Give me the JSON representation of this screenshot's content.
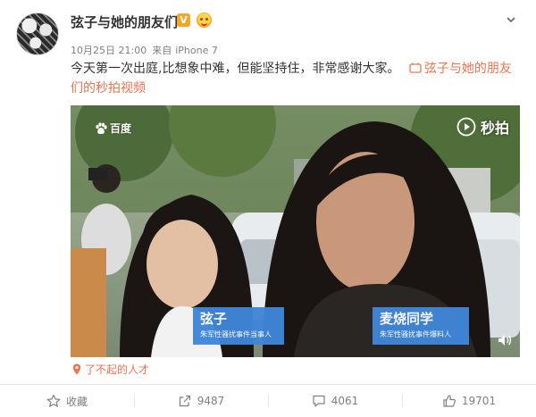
{
  "post": {
    "username": "弦子与她的朋友们",
    "verified_badge": "V",
    "date": "10月25日 21:00",
    "source_prefix": "来自",
    "source": "iPhone 7",
    "text": "今天第一次出庭,比想象中难，但能坚持住，非常感谢大家。",
    "video_link": "弦子与她的朋友们的秒拍视频",
    "topic": "了不起的人才"
  },
  "video": {
    "watermark_left": "百度",
    "watermark_right": "秒拍",
    "caption_left": {
      "name": "弦子",
      "role": "朱军性骚扰事件当事人"
    },
    "caption_right": {
      "name": "麦烧同学",
      "role": "朱军性骚扰事件爆料人"
    }
  },
  "actions": [
    {
      "icon": "star-icon",
      "label": "收藏"
    },
    {
      "icon": "share-icon",
      "label": "9487"
    },
    {
      "icon": "comment-icon",
      "label": "4061"
    },
    {
      "icon": "like-icon",
      "label": "19701"
    }
  ],
  "colors": {
    "link": "#eb7350",
    "caption_bg": "#3f86d8",
    "badge": "#f5a623"
  }
}
